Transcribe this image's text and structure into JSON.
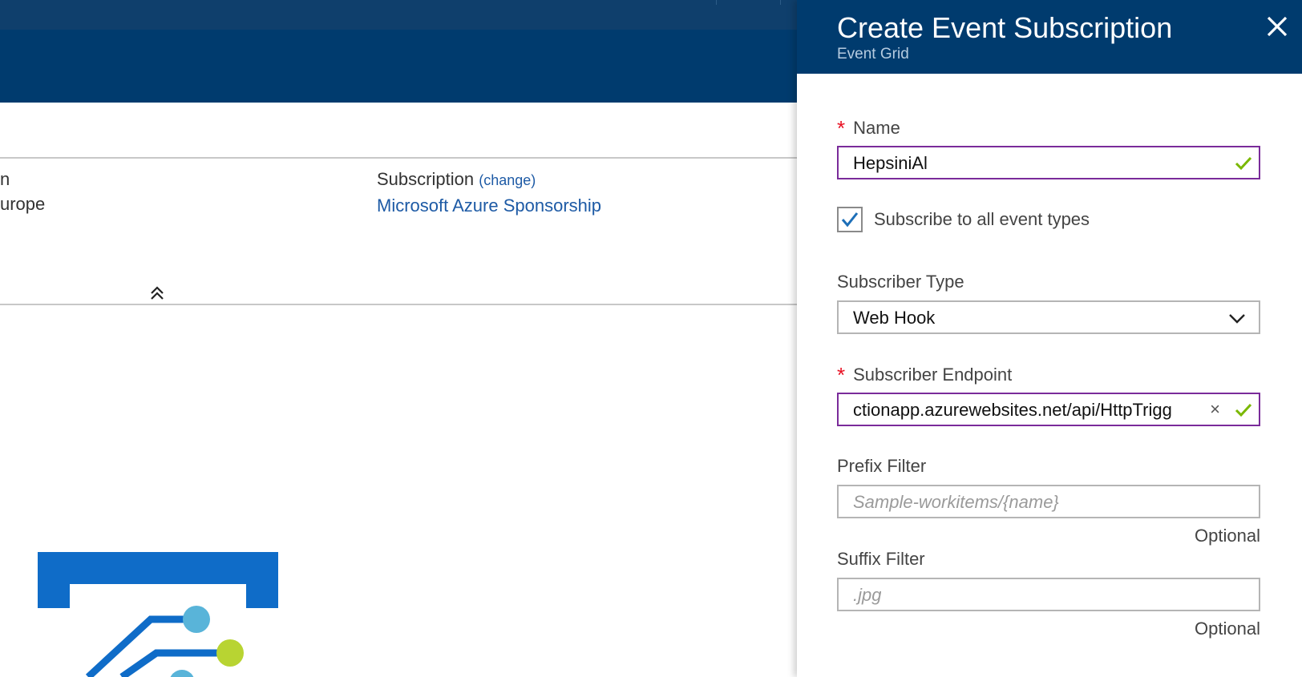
{
  "background": {
    "essentials": {
      "left_line1": "n",
      "left_line2": "urope",
      "subscription_label": "Subscription",
      "change_link": "(change)",
      "subscription_value": "Microsoft Azure Sponsorship"
    }
  },
  "panel": {
    "title": "Create Event Subscription",
    "subtitle": "Event Grid",
    "fields": {
      "name": {
        "label": "Name",
        "required_mark": "*",
        "value": "HepsiniAl"
      },
      "subscribe_all": {
        "label": "Subscribe to all event types",
        "checked": true
      },
      "subscriber_type": {
        "label": "Subscriber Type",
        "value": "Web Hook"
      },
      "endpoint": {
        "label": "Subscriber Endpoint",
        "required_mark": "*",
        "value": "ctionapp.azurewebsites.net/api/HttpTrigg"
      },
      "prefix_filter": {
        "label": "Prefix Filter",
        "placeholder": "Sample-workitems/{name}",
        "hint": "Optional"
      },
      "suffix_filter": {
        "label": "Suffix Filter",
        "placeholder": ".jpg",
        "hint": "Optional"
      }
    }
  },
  "colors": {
    "header_bg": "#003b6e",
    "link": "#1d5aa5",
    "required": "#e81123",
    "valid_check": "#7ab800",
    "active_border": "#7a2b9a"
  },
  "icons": [
    "close-icon",
    "check-icon",
    "chevron-down-icon",
    "collapse-up-icon",
    "clear-icon",
    "event-grid-logo"
  ]
}
